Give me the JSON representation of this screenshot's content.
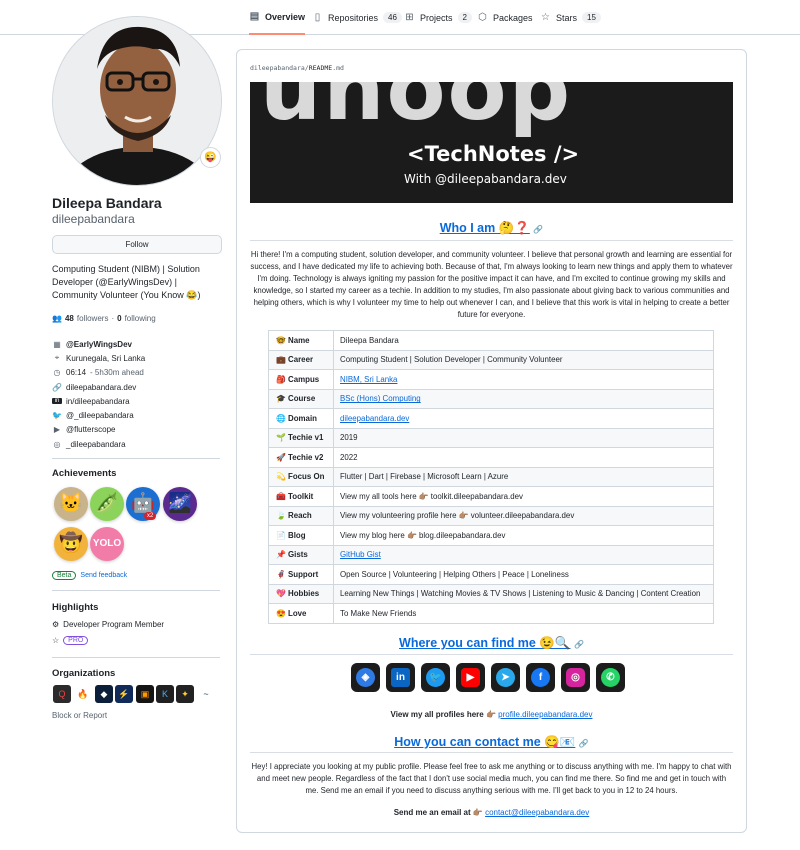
{
  "nav": {
    "tabs": [
      {
        "label": "Overview",
        "count": ""
      },
      {
        "label": "Repositories",
        "count": "46"
      },
      {
        "label": "Projects",
        "count": "2"
      },
      {
        "label": "Packages",
        "count": ""
      },
      {
        "label": "Stars",
        "count": "15"
      }
    ]
  },
  "profile": {
    "status_emoji": "😜",
    "fullname": "Dileepa Bandara",
    "username": "dileepabandara",
    "follow_label": "Follow",
    "bio": "Computing Student (NIBM) | Solution Developer (@EarlyWingsDev) | Community Volunteer (You Know 😂)",
    "followers_count": "48",
    "followers_label": "followers",
    "following_count": "0",
    "following_label": "following",
    "separator": "·",
    "org": "@EarlyWingsDev",
    "location": "Kurunegala, Sri Lanka",
    "local_time": "06:14",
    "time_note": "- 5h30m ahead",
    "website": "dileepabandara.dev",
    "linkedin": "in/dileepabandara",
    "twitter": "@_dileepabandara",
    "youtube": "@flutterscope",
    "instagram": "_dileepabandara"
  },
  "achievements": {
    "title": "Achievements",
    "badges": [
      "🐱",
      "🫛",
      "🤖",
      "🌌",
      "🤠",
      "YOLO"
    ],
    "multiplier": "x2",
    "beta_label": "Beta",
    "feedback_label": "Send feedback"
  },
  "highlights": {
    "title": "Highlights",
    "item": "Developer Program Member",
    "pro_label": "PRO"
  },
  "organizations": {
    "title": "Organizations",
    "items": [
      {
        "glyph": "Q",
        "color": "#2b2b2b"
      },
      {
        "glyph": "🔥",
        "color": "#ffffff"
      },
      {
        "glyph": "◆",
        "color": "#0b1f3a"
      },
      {
        "glyph": "⚡",
        "color": "#102a5a"
      },
      {
        "glyph": "▣",
        "color": "#151515"
      },
      {
        "glyph": "K",
        "color": "#202020"
      },
      {
        "glyph": "✦",
        "color": "#222222"
      },
      {
        "glyph": "~",
        "color": "#ffffff"
      }
    ],
    "block_label": "Block or Report"
  },
  "readme": {
    "crumb_user": "dileepabandara",
    "crumb_sep": "/",
    "crumb_file": "README",
    "crumb_ext": ".md",
    "banner_title": "<TechNotes />",
    "banner_sub": "With @dileepabandara.dev",
    "who_heading": "Who I am 🤔❓",
    "who_para": "Hi there! I'm a computing student, solution developer, and community volunteer. I believe that personal growth and learning are essential for success, and I have dedicated my life to achieving both. Because of that, I'm always looking to learn new things and apply them to whatever I'm doing. Technology is always igniting my passion for the positive impact it can have, and I'm excited to continue growing my skills and knowledge, so I started my career as a techie. In addition to my studies, I'm also passionate about giving back to various communities and helping others, which is why I volunteer my time to help out whenever I can, and I believe that this work is vital in helping to create a better future for everyone.",
    "table": [
      {
        "key": "🤓 Name",
        "value": "Dileepa Bandara"
      },
      {
        "key": "💼 Career",
        "value": "Computing Student | Solution Developer | Community Volunteer"
      },
      {
        "key": "🎒 Campus",
        "value": "NIBM, Sri Lanka"
      },
      {
        "key": "🎓 Course",
        "value": "BSc (Hons) Computing"
      },
      {
        "key": "🌐 Domain",
        "value": "dileepabandara.dev"
      },
      {
        "key": "🌱 Techie v1",
        "value": "2019"
      },
      {
        "key": "🚀 Techie v2",
        "value": "2022"
      },
      {
        "key": "💫 Focus On",
        "value": "Flutter | Dart | Firebase | Microsoft Learn | Azure"
      },
      {
        "key": "🧰 Toolkit",
        "value": "View my all tools here 👉🏽 toolkit.dileepabandara.dev"
      },
      {
        "key": "🍃 Reach",
        "value": "View my volunteering profile here 👉🏽 volunteer.dileepabandara.dev"
      },
      {
        "key": "📄 Blog",
        "value": "View my blog here 👉🏽 blog.dileepabandara.dev"
      },
      {
        "key": "📌 Gists",
        "value": "GitHub Gist"
      },
      {
        "key": "🦸 Support",
        "value": "Open Source | Volunteering | Helping Others | Peace | Loneliness"
      },
      {
        "key": "💖 Hobbies",
        "value": "Learning New Things | Watching Movies & TV Shows | Listening to Music & Dancing | Content Creation"
      },
      {
        "key": "😍 Love",
        "value": "To Make New Friends"
      }
    ],
    "find_heading": "Where you can find me 😉🔍",
    "socials": [
      "◈",
      "in",
      "🐦",
      "▶",
      "➤",
      "f",
      "◎",
      "✆"
    ],
    "profiles_prefix": "View my all profiles here 👉🏽",
    "profiles_link": "profile.dileepabandara.dev",
    "contact_heading": "How you can contact me 😋📧",
    "contact_para": "Hey! I appreciate you looking at my public profile. Please feel free to ask me anything or to discuss anything with me. I'm happy to chat with and meet new people. Regardless of the fact that I don't use social media much, you can find me there. So find me and get in touch with me. Send me an email if you need to discuss anything serious with me. I'll get back to you in 12 to 24 hours.",
    "email_prefix": "Send me an email at 👉🏽",
    "email_link": "contact@dileepabandara.dev"
  }
}
